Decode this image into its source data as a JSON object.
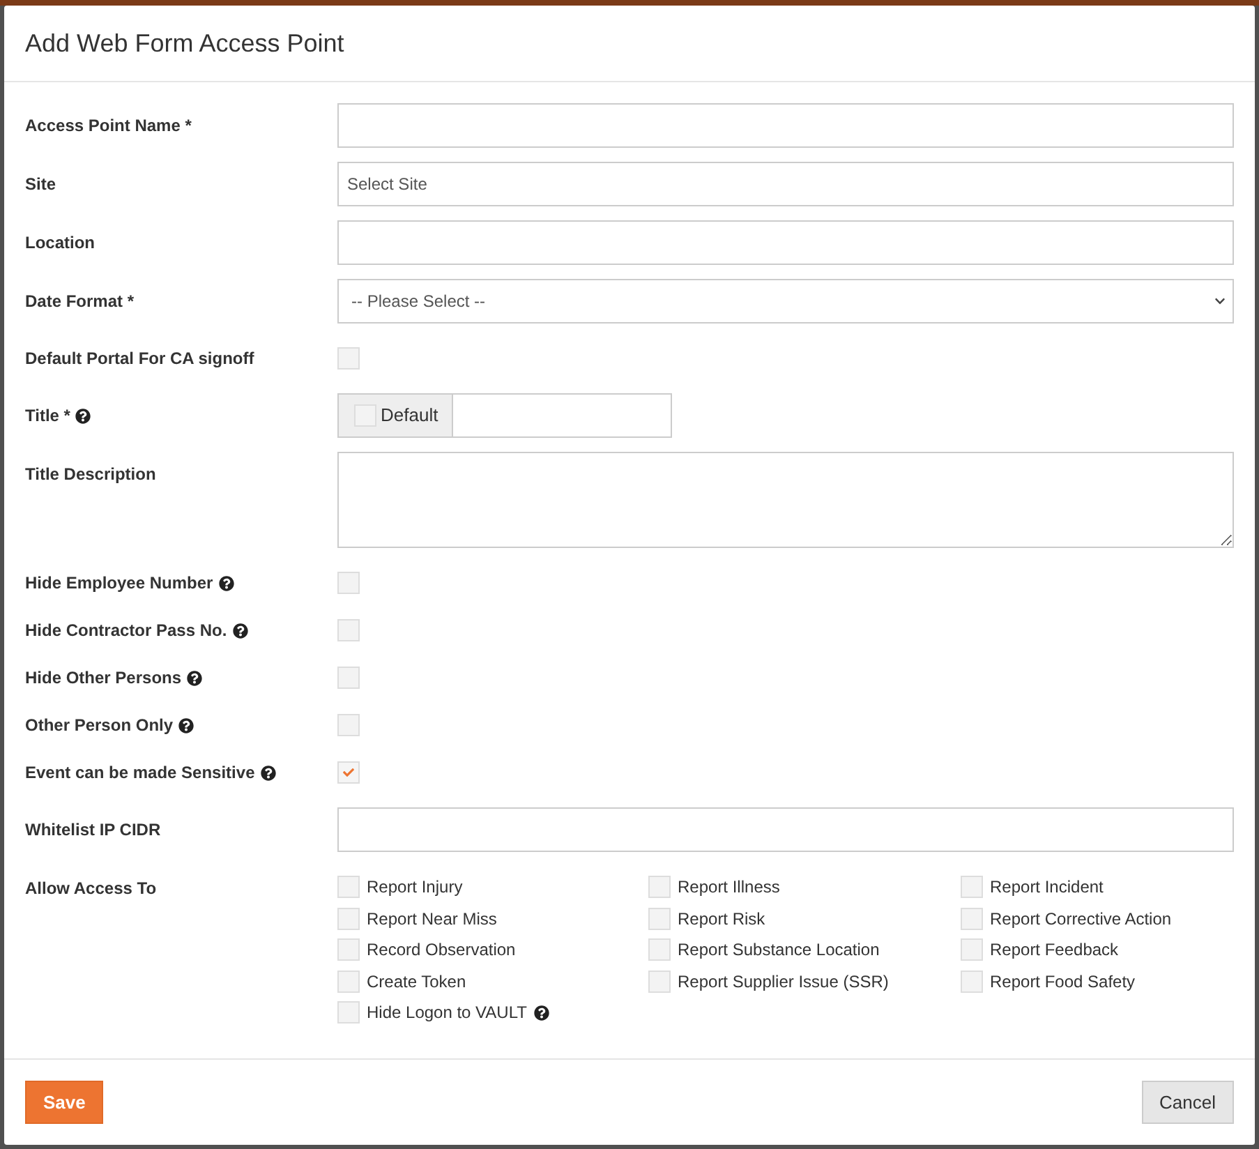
{
  "dialog": {
    "title": "Add Web Form Access Point"
  },
  "fields": [
    {
      "kind": "text",
      "label": "Access Point Name *",
      "help": false
    },
    {
      "kind": "text",
      "label": "Site",
      "help": false,
      "placeholder": "Select Site"
    },
    {
      "kind": "text",
      "label": "Location",
      "help": false
    },
    {
      "kind": "select",
      "label": "Date Format *",
      "help": false,
      "value": "-- Please Select --"
    },
    {
      "kind": "checkbox",
      "label": "Default Portal For CA signoff",
      "help": false,
      "checked": false
    },
    {
      "kind": "addon",
      "label": "Title *",
      "help": true,
      "addon": {
        "label": "Default",
        "checked": false
      }
    },
    {
      "kind": "textarea",
      "label": "Title Description",
      "help": false
    },
    {
      "kind": "checkbox",
      "label": "Hide Employee Number",
      "help": true,
      "checked": false
    },
    {
      "kind": "checkbox",
      "label": "Hide Contractor Pass No.",
      "help": true,
      "checked": false
    },
    {
      "kind": "checkbox",
      "label": "Hide Other Persons",
      "help": true,
      "checked": false
    },
    {
      "kind": "checkbox",
      "label": "Other Person Only",
      "help": true,
      "checked": false
    },
    {
      "kind": "checkbox",
      "label": "Event can be made Sensitive",
      "help": true,
      "checked": true
    },
    {
      "kind": "text",
      "label": "Whitelist IP CIDR",
      "help": false
    },
    {
      "kind": "checklist",
      "label": "Allow Access To",
      "help": false,
      "options": [
        {
          "label": "Report Injury",
          "checked": false,
          "help": false
        },
        {
          "label": "Report Illness",
          "checked": false,
          "help": false
        },
        {
          "label": "Report Incident",
          "checked": false,
          "help": false
        },
        {
          "label": "Report Near Miss",
          "checked": false,
          "help": false
        },
        {
          "label": "Report Risk",
          "checked": false,
          "help": false
        },
        {
          "label": "Report Corrective Action",
          "checked": false,
          "help": false
        },
        {
          "label": "Record Observation",
          "checked": false,
          "help": false
        },
        {
          "label": "Report Substance Location",
          "checked": false,
          "help": false
        },
        {
          "label": "Report Feedback",
          "checked": false,
          "help": false
        },
        {
          "label": "Create Token",
          "checked": false,
          "help": false
        },
        {
          "label": "Report Supplier Issue (SSR)",
          "checked": false,
          "help": false
        },
        {
          "label": "Report Food Safety",
          "checked": false,
          "help": false
        },
        {
          "label": "Hide Logon to VAULT",
          "checked": false,
          "help": true
        }
      ]
    }
  ],
  "footer": {
    "buttons": [
      {
        "kind": "primary",
        "label": "Save"
      },
      {
        "kind": "secondary",
        "label": "Cancel"
      }
    ]
  }
}
